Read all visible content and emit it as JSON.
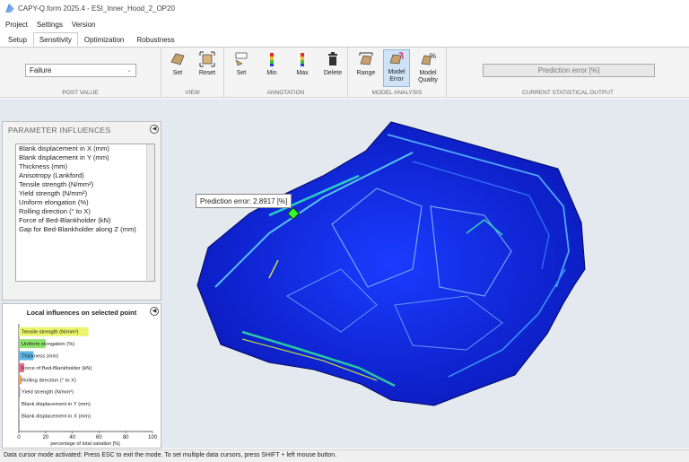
{
  "window": {
    "title": "CAPY-Q.form 2025.4 - ESI_Inner_Hood_2_OP20"
  },
  "menu": [
    "Project",
    "Settings",
    "Version"
  ],
  "tabs": [
    {
      "label": "Setup",
      "active": false
    },
    {
      "label": "Sensitivity",
      "active": true
    },
    {
      "label": "Optimization",
      "active": false
    },
    {
      "label": "Robustness",
      "active": false
    }
  ],
  "ribbon": {
    "post_value": {
      "selected": "Failure",
      "group_label": "POST VALUE"
    },
    "view": {
      "set": "Set",
      "reset": "Reset",
      "group_label": "VIEW"
    },
    "annotation": {
      "set": "Set",
      "min": "Min",
      "max": "Max",
      "delete": "Delete",
      "group_label": "ANNOTATION"
    },
    "model_analysis": {
      "range": "Range",
      "model_error": "Model\nError",
      "model_quality": "Model\nQuality",
      "group_label": "MODEL ANALYSIS"
    },
    "statistical_output": {
      "value": "Prediction error [%]",
      "group_label": "CURRENT STATISTICAL OUTPUT"
    }
  },
  "parameter_panel": {
    "title": "PARAMETER INFLUENCES",
    "items": [
      "Blank displacement in X (mm)",
      "Blank displacement in Y (mm)",
      "Thickness (mm)",
      "Anisotropy (Lankford)",
      "Tensile strength (N/mm²)",
      "Yield strength (N/mm²)",
      "Uniform elongation (%)",
      "Rolling direction (° to X)",
      "Force of Bed-Blankholder (kN)",
      "Gap for Bed-Blankholder along Z (mm)"
    ]
  },
  "tooltip": {
    "text": "Prediction error: 2.8917 [%]"
  },
  "chart_data": {
    "type": "bar",
    "orientation": "horizontal",
    "title": "Local influences on selected point",
    "xlabel": "percentage of total variation [%]",
    "ylabel": "",
    "xlim": [
      0,
      100
    ],
    "xticks": [
      0,
      20,
      40,
      60,
      80,
      100
    ],
    "categories": [
      "Tensile strength (N/mm²)",
      "Uniform elongation (%)",
      "Thickness (mm)",
      "Force of Bed-Blankholder (kN)",
      "Rolling direction (° to X)",
      "Yield strength (N/mm²)",
      "Blank displacement in Y (mm)",
      "Blank displacement in X (mm)"
    ],
    "values": [
      52,
      20,
      11,
      4,
      2,
      1,
      0.5,
      0.4
    ],
    "colors": [
      "#ecf56a",
      "#8ee26a",
      "#5ab6e6",
      "#e86a8a",
      "#f0a050",
      "#c47ae0",
      "#7ad0c0",
      "#9a9ad6"
    ],
    "grid": false,
    "legend": "none"
  },
  "status": "Data cursor mode activated: Press ESC to exit the mode. To set multiple data cursors, press SHIFT + left mouse button."
}
